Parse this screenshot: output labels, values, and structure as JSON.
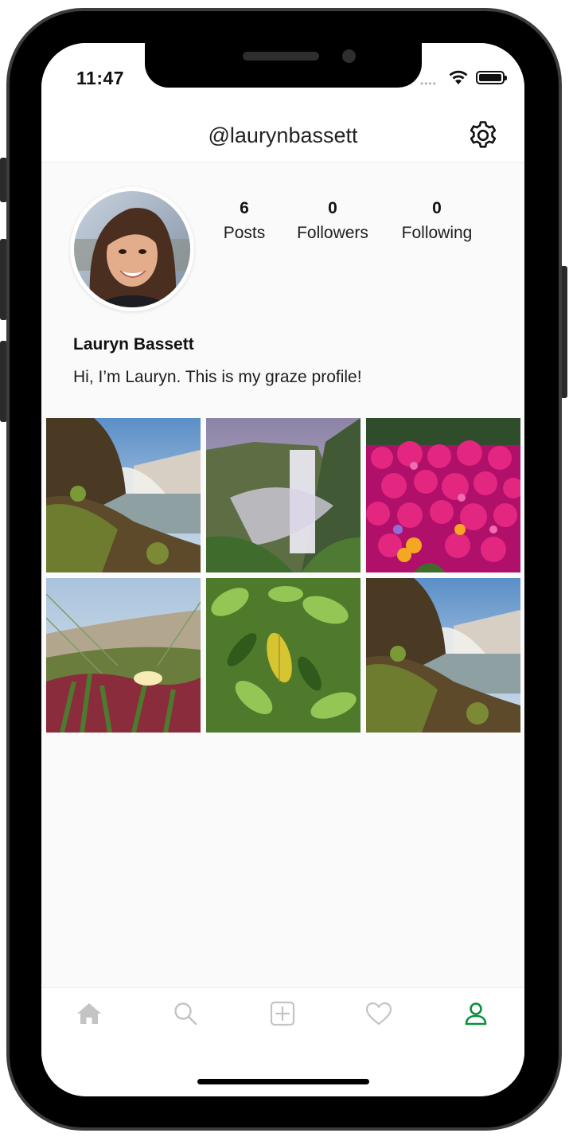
{
  "status_bar": {
    "time": "11:47",
    "signal_icon": "signal-dots-icon",
    "wifi_icon": "wifi-icon",
    "battery_icon": "battery-icon"
  },
  "header": {
    "username": "@laurynbassett",
    "settings_icon": "gear-icon"
  },
  "profile": {
    "full_name": "Lauryn Bassett",
    "bio": "Hi, I’m Lauryn. This is my graze profile!",
    "stats": [
      {
        "value": "6",
        "label": "Posts"
      },
      {
        "value": "0",
        "label": "Followers"
      },
      {
        "value": "0",
        "label": "Following"
      }
    ]
  },
  "posts": [
    {
      "subject": "waterfall-coastline"
    },
    {
      "subject": "waterfall-misty-valley"
    },
    {
      "subject": "pink-flowers"
    },
    {
      "subject": "dune-grass-flower"
    },
    {
      "subject": "green-leaves"
    },
    {
      "subject": "waterfall-coastline"
    }
  ],
  "tab_bar": {
    "tabs": [
      {
        "name": "home",
        "icon": "home-icon",
        "active": false
      },
      {
        "name": "search",
        "icon": "search-icon",
        "active": false
      },
      {
        "name": "add",
        "icon": "add-square-icon",
        "active": false
      },
      {
        "name": "activity",
        "icon": "heart-icon",
        "active": false
      },
      {
        "name": "profile",
        "icon": "user-icon",
        "active": true
      }
    ],
    "active_color": "#0a8f3c",
    "inactive_color": "#c4c4c4"
  }
}
